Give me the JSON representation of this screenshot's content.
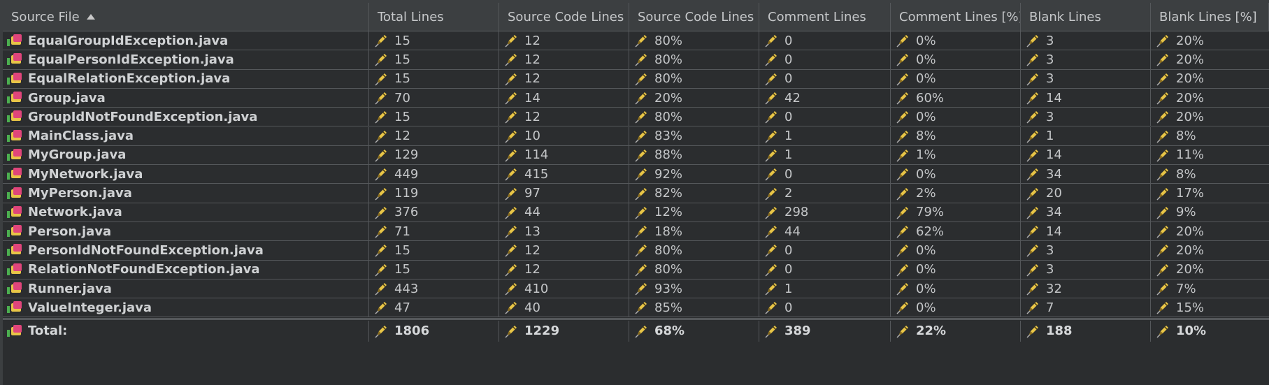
{
  "columns": [
    {
      "label": "Source File",
      "sorted": "asc"
    },
    {
      "label": "Total Lines"
    },
    {
      "label": "Source Code Lines"
    },
    {
      "label": "Source Code Lines ..."
    },
    {
      "label": "Comment Lines"
    },
    {
      "label": "Comment Lines [%]"
    },
    {
      "label": "Blank Lines"
    },
    {
      "label": "Blank Lines [%]"
    }
  ],
  "rows": [
    {
      "file": "EqualGroupIdException.java",
      "total": "15",
      "code": "12",
      "code_pct": "80%",
      "comment": "0",
      "comment_pct": "0%",
      "blank": "3",
      "blank_pct": "20%"
    },
    {
      "file": "EqualPersonIdException.java",
      "total": "15",
      "code": "12",
      "code_pct": "80%",
      "comment": "0",
      "comment_pct": "0%",
      "blank": "3",
      "blank_pct": "20%"
    },
    {
      "file": "EqualRelationException.java",
      "total": "15",
      "code": "12",
      "code_pct": "80%",
      "comment": "0",
      "comment_pct": "0%",
      "blank": "3",
      "blank_pct": "20%"
    },
    {
      "file": "Group.java",
      "total": "70",
      "code": "14",
      "code_pct": "20%",
      "comment": "42",
      "comment_pct": "60%",
      "blank": "14",
      "blank_pct": "20%"
    },
    {
      "file": "GroupIdNotFoundException.java",
      "total": "15",
      "code": "12",
      "code_pct": "80%",
      "comment": "0",
      "comment_pct": "0%",
      "blank": "3",
      "blank_pct": "20%"
    },
    {
      "file": "MainClass.java",
      "total": "12",
      "code": "10",
      "code_pct": "83%",
      "comment": "1",
      "comment_pct": "8%",
      "blank": "1",
      "blank_pct": "8%"
    },
    {
      "file": "MyGroup.java",
      "total": "129",
      "code": "114",
      "code_pct": "88%",
      "comment": "1",
      "comment_pct": "1%",
      "blank": "14",
      "blank_pct": "11%"
    },
    {
      "file": "MyNetwork.java",
      "total": "449",
      "code": "415",
      "code_pct": "92%",
      "comment": "0",
      "comment_pct": "0%",
      "blank": "34",
      "blank_pct": "8%"
    },
    {
      "file": "MyPerson.java",
      "total": "119",
      "code": "97",
      "code_pct": "82%",
      "comment": "2",
      "comment_pct": "2%",
      "blank": "20",
      "blank_pct": "17%"
    },
    {
      "file": "Network.java",
      "total": "376",
      "code": "44",
      "code_pct": "12%",
      "comment": "298",
      "comment_pct": "79%",
      "blank": "34",
      "blank_pct": "9%"
    },
    {
      "file": "Person.java",
      "total": "71",
      "code": "13",
      "code_pct": "18%",
      "comment": "44",
      "comment_pct": "62%",
      "blank": "14",
      "blank_pct": "20%"
    },
    {
      "file": "PersonIdNotFoundException.java",
      "total": "15",
      "code": "12",
      "code_pct": "80%",
      "comment": "0",
      "comment_pct": "0%",
      "blank": "3",
      "blank_pct": "20%"
    },
    {
      "file": "RelationNotFoundException.java",
      "total": "15",
      "code": "12",
      "code_pct": "80%",
      "comment": "0",
      "comment_pct": "0%",
      "blank": "3",
      "blank_pct": "20%"
    },
    {
      "file": "Runner.java",
      "total": "443",
      "code": "410",
      "code_pct": "93%",
      "comment": "1",
      "comment_pct": "0%",
      "blank": "32",
      "blank_pct": "7%"
    },
    {
      "file": "ValueInteger.java",
      "total": "47",
      "code": "40",
      "code_pct": "85%",
      "comment": "0",
      "comment_pct": "0%",
      "blank": "7",
      "blank_pct": "15%"
    }
  ],
  "total_row": {
    "file": "Total:",
    "total": "1806",
    "code": "1229",
    "code_pct": "68%",
    "comment": "389",
    "comment_pct": "22%",
    "blank": "188",
    "blank_pct": "10%"
  },
  "icons": {
    "file": "java-class-icon",
    "value": "pencil-icon"
  },
  "colors": {
    "background": "#2b2d2f",
    "header": "#3c3f41",
    "grid_line": "#55585b",
    "icon_green": "#4caf50",
    "icon_pink": "#e0457b",
    "icon_yellow": "#e8c547"
  }
}
